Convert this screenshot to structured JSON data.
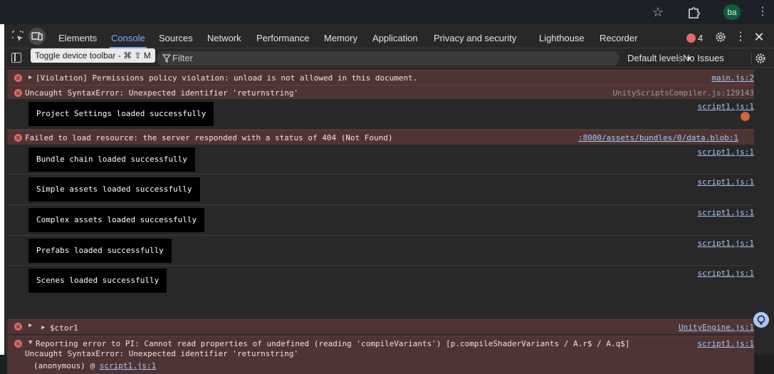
{
  "browser": {
    "avatar_initials": "ba"
  },
  "devtools": {
    "tabs": [
      {
        "label": "Elements"
      },
      {
        "label": "Console"
      },
      {
        "label": "Sources"
      },
      {
        "label": "Network"
      },
      {
        "label": "Performance"
      },
      {
        "label": "Memory"
      },
      {
        "label": "Application"
      },
      {
        "label": "Privacy and security"
      },
      {
        "label": "Lighthouse"
      },
      {
        "label": "Recorder"
      }
    ],
    "active_tab": "Console",
    "error_count": "4",
    "tooltip": "Toggle device toolbar - ⌘ ⇧ M"
  },
  "filterbar": {
    "filter_placeholder": "Filter",
    "levels_label": "Default levels",
    "issues_label": "No Issues"
  },
  "console": {
    "messages": [
      {
        "type": "error",
        "text": "[Violation] Permissions policy violation: unload is not allowed in this document.",
        "source": "main.js:2"
      },
      {
        "type": "error",
        "text": "Uncaught SyntaxError: Unexpected identifier 'returnstring'",
        "source": "UnityScriptsCompiler.js:129143"
      },
      {
        "type": "log",
        "text": "Project Settings loaded successfully",
        "source": "script1.js:1"
      },
      {
        "type": "error",
        "text": "Failed to load resource: the server responded with a status of 404 (Not Found)",
        "source": ":8000/assets/bundles/0/data.blob:1"
      },
      {
        "type": "log",
        "text": "Bundle chain loaded successfully",
        "source": "script1.js:1"
      },
      {
        "type": "log",
        "text": "Simple assets loaded successfully",
        "source": "script1.js:1"
      },
      {
        "type": "log",
        "text": "Complex assets loaded successfully",
        "source": "script1.js:1"
      },
      {
        "type": "log",
        "text": "Prefabs loaded successfully",
        "source": "script1.js:1"
      },
      {
        "type": "log",
        "text": "Scenes loaded successfully",
        "source": "script1.js:1"
      },
      {
        "type": "error",
        "text": "$ctor1",
        "source": "UnityEngine.js:1"
      },
      {
        "type": "error",
        "text": "Reporting error to PI: Cannot read properties of undefined (reading 'compileVariants') [p.compileShaderVariants / A.r$ / A.q$]",
        "source": "script1.js:1",
        "line2": "Uncaught SyntaxError: Unexpected identifier 'returnstring'",
        "stack_prefix": "(anonymous) @ ",
        "stack_link": "script1.js:1"
      }
    ]
  }
}
